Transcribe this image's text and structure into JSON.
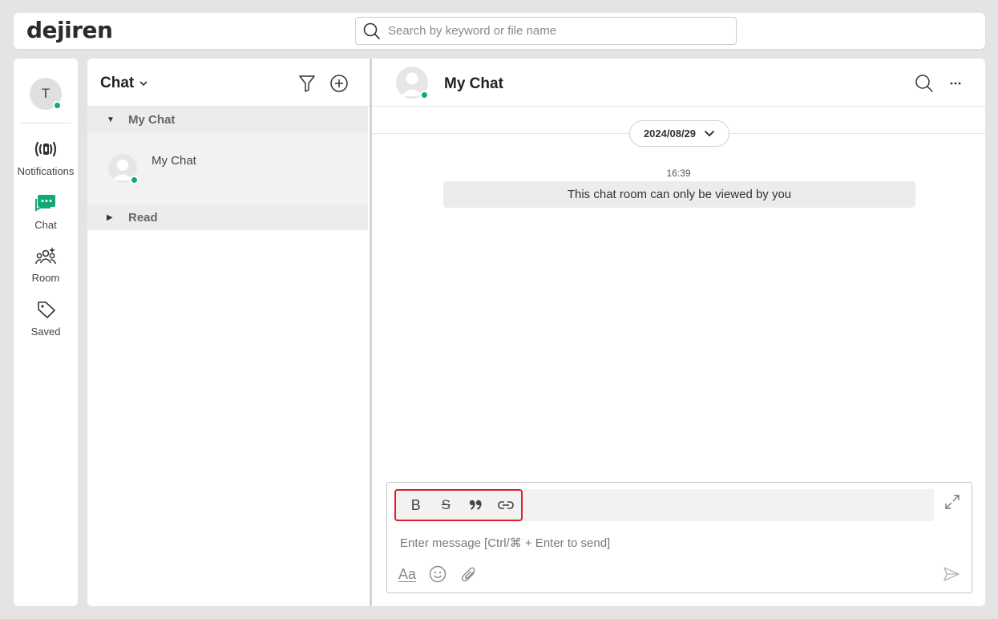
{
  "header": {
    "logo": "dejiren",
    "search_placeholder": "Search by keyword or file name"
  },
  "nav": {
    "user_initial": "T",
    "items": [
      {
        "label": "Notifications"
      },
      {
        "label": "Chat"
      },
      {
        "label": "Room"
      },
      {
        "label": "Saved"
      }
    ],
    "colors": {
      "active": "#12a975",
      "online": "#12a975"
    }
  },
  "chat_list": {
    "title": "Chat",
    "groups": [
      {
        "label": "My Chat",
        "expanded": true
      },
      {
        "label": "Read",
        "expanded": false
      }
    ],
    "items": [
      {
        "name": "My Chat"
      }
    ]
  },
  "main": {
    "title": "My Chat",
    "date": "2024/08/29",
    "messages": [
      {
        "time": "16:39",
        "text": "This chat room can only be viewed by you"
      }
    ]
  },
  "composer": {
    "placeholder": "Enter message [Ctrl/⌘ + Enter to send]",
    "format_buttons": [
      "bold-icon",
      "strikethrough-icon",
      "quote-icon",
      "link-icon"
    ],
    "text_format_label": "Aa",
    "highlight_color": "#e11d2a"
  }
}
